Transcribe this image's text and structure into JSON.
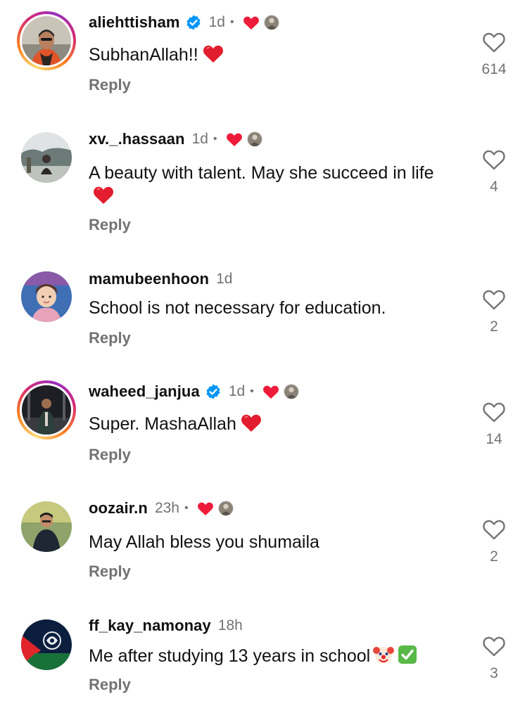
{
  "comments": [
    {
      "username": "aliehttisham",
      "verified": true,
      "time": "1d",
      "creator_liked": true,
      "text": "SubhanAllah!!",
      "emoji": "red-heart",
      "reply_label": "Reply",
      "likes": "614"
    },
    {
      "username": "xv._.hassaan",
      "verified": false,
      "time": "1d",
      "creator_liked": true,
      "text": "A beauty with talent. May she succeed in life",
      "emoji": "red-heart",
      "reply_label": "Reply",
      "likes": "4"
    },
    {
      "username": "mamubeenhoon",
      "verified": false,
      "time": "1d",
      "creator_liked": false,
      "text": "School is not necessary for education.",
      "emoji": "",
      "reply_label": "Reply",
      "likes": "2"
    },
    {
      "username": "waheed_janjua",
      "verified": true,
      "time": "1d",
      "creator_liked": true,
      "text": "Super. MashaAllah",
      "emoji": "red-heart",
      "reply_label": "Reply",
      "likes": "14"
    },
    {
      "username": "oozair.n",
      "verified": false,
      "time": "23h",
      "creator_liked": true,
      "text": "May Allah bless you shumaila",
      "emoji": "",
      "reply_label": "Reply",
      "likes": "2"
    },
    {
      "username": "ff_kay_namonay",
      "verified": false,
      "time": "18h",
      "creator_liked": false,
      "text": "Me after studying 13 years in school",
      "emoji": "clown-face, check-mark-button",
      "reply_label": "Reply",
      "likes": "3"
    }
  ],
  "separator": "•",
  "colors": {
    "heart_red": "#ed1c3a",
    "verified_blue": "#0095f6",
    "secondary_text": "#737373"
  },
  "icons": {
    "like": "heart-outline-icon",
    "creator_like": "heart-filled-icon",
    "verified": "verified-badge-icon"
  }
}
